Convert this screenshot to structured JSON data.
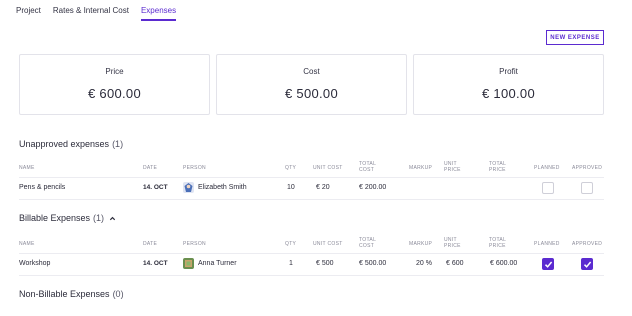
{
  "tabs": [
    {
      "label": "Project"
    },
    {
      "label": "Rates & Internal Cost"
    },
    {
      "label": "Expenses"
    }
  ],
  "new_expense_label": "NEW EXPENSE",
  "cards": [
    {
      "label": "Price",
      "value": "€ 600.00"
    },
    {
      "label": "Cost",
      "value": "€ 500.00"
    },
    {
      "label": "Profit",
      "value": "€ 100.00"
    }
  ],
  "columns": {
    "name": "NAME",
    "date": "DATE",
    "person": "PERSON",
    "qty": "QTY",
    "unit_cost": "UNIT COST",
    "total_cost_1": "TOTAL",
    "total_cost_2": "COST",
    "markup": "MARKUP",
    "unit_price_1": "UNIT",
    "unit_price_2": "PRICE",
    "total_price_1": "TOTAL",
    "total_price_2": "PRICE",
    "planned": "PLANNED",
    "approved": "APPROVED"
  },
  "unapproved": {
    "title": "Unapproved expenses",
    "count": "(1)",
    "row": {
      "name": "Pens & pencils",
      "date": "14. OCT",
      "person": "Elizabeth Smith",
      "qty": "10",
      "unit_cost": "€ 20",
      "total_cost": "€ 200.00",
      "markup": "",
      "unit_price": "",
      "total_price": "",
      "planned": false,
      "approved": false
    }
  },
  "billable": {
    "title": "Billable Expenses",
    "count": "(1)",
    "row": {
      "name": "Workshop",
      "date": "14. OCT",
      "person": "Anna Turner",
      "qty": "1",
      "unit_cost": "€ 500",
      "total_cost": "€ 500.00",
      "markup": "20 %",
      "unit_price": "€ 600",
      "total_price": "€ 600.00",
      "planned": true,
      "approved": true
    }
  },
  "non_billable": {
    "title": "Non-Billable Expenses",
    "count": "(0)"
  },
  "colors": {
    "accent": "#5b2bd0"
  }
}
